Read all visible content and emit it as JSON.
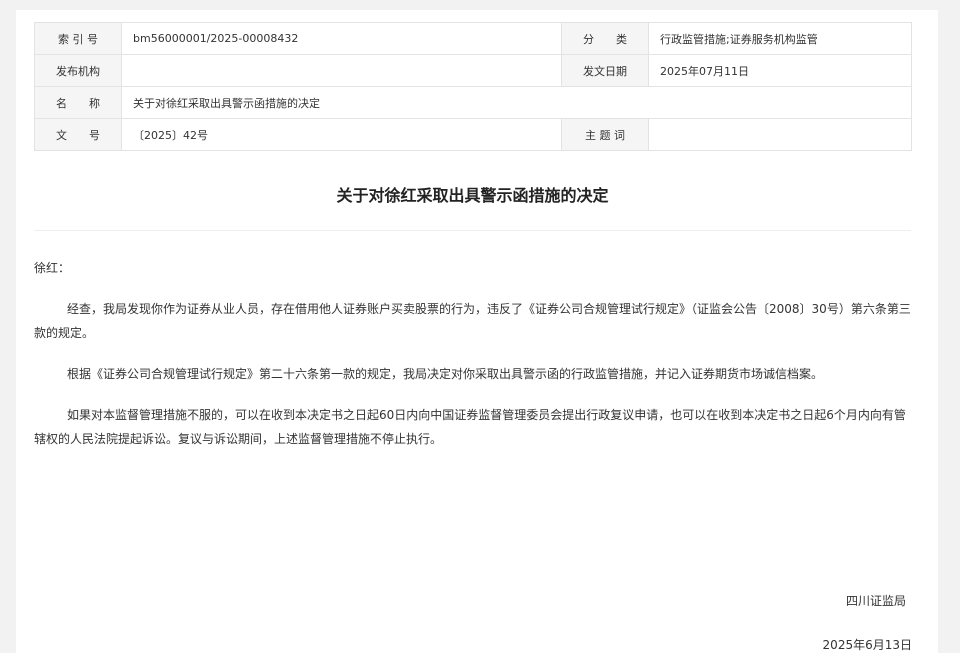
{
  "meta": {
    "index_label": "索 引 号",
    "index_value": "bm56000001/2025-00008432",
    "category_label": "分　　类",
    "category_value": "行政监管措施;证券服务机构监管",
    "publisher_label": "发布机构",
    "publisher_value": "",
    "date_label": "发文日期",
    "date_value": "2025年07月11日",
    "name_label": "名　　称",
    "name_value": "关于对徐红采取出具警示函措施的决定",
    "docno_label": "文　　号",
    "docno_value": "〔2025〕42号",
    "keywords_label": "主 题 词",
    "keywords_value": ""
  },
  "document": {
    "title": "关于对徐红采取出具警示函措施的决定",
    "salutation": "徐红：",
    "paragraphs": [
      "经查，我局发现你作为证券从业人员，存在借用他人证券账户买卖股票的行为，违反了《证券公司合规管理试行规定》（证监会公告〔2008〕30号）第六条第三款的规定。",
      "根据《证券公司合规管理试行规定》第二十六条第一款的规定，我局决定对你采取出具警示函的行政监管措施，并记入证券期货市场诚信档案。",
      "如果对本监督管理措施不服的，可以在收到本决定书之日起60日内向中国证券监督管理委员会提出行政复议申请，也可以在收到本决定书之日起6个月内向有管辖权的人民法院提起诉讼。复议与诉讼期间，上述监督管理措施不停止执行。"
    ],
    "signature_org": "四川证监局",
    "signature_date": "2025年6月13日"
  }
}
